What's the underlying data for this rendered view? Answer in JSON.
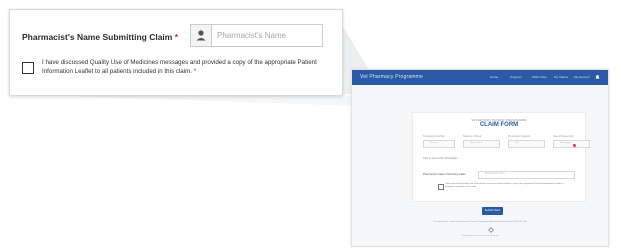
{
  "callout": {
    "pharmacist_label": "Pharmacist's Name Submitting Claim",
    "required_mark": "*",
    "pharmacist_placeholder": "Pharmacist's Name",
    "consent_text": "I have discussed Quality Use of Medicines messages and provided a copy of the appropriate Patient Information Leaflet to all patients included in this claim.",
    "consent_checked": false
  },
  "thumbnail": {
    "brand": "Vet Pharmacy Programme",
    "nav": [
      "Home",
      "Program",
      "Claim Now",
      "My Claims",
      "My Account"
    ],
    "form_subtitle": "VETERINARY PATIENT PROGRAMME",
    "form_title": "CLAIM FORM",
    "columns": [
      "Prescription Number",
      "Medicine Offered",
      "Prescription Quantity",
      "Date of Dispensing"
    ],
    "field_placeholders": [
      "Number",
      "Please select",
      "Qty",
      "dd/mm/yyyy"
    ],
    "add_row_prefix": "Click to add another",
    "add_row_link": "Prescription",
    "pharmacist_label": "Pharmacist's Name Submitting Claim",
    "pharmacist_placeholder": "Pharmacist's Name",
    "consent_text": "I have discussed Quality Use of Medicines messages and provided a copy of the appropriate Patient Information Leaflet to all patients included in this claim.",
    "submit_label": "Submit Claim",
    "footnote": "For assistance, contact the Veterinary Patient Programme Administration Team on 1800 021 035",
    "footer_small": "Supported by the Pharmacy Guild of Australia"
  },
  "colors": {
    "accent": "#2a5aa5",
    "required": "#d9262b"
  },
  "icons": {
    "field_icon": "user-icon",
    "nav_icon": "bell-icon",
    "footer_icon": "logo-mark"
  }
}
